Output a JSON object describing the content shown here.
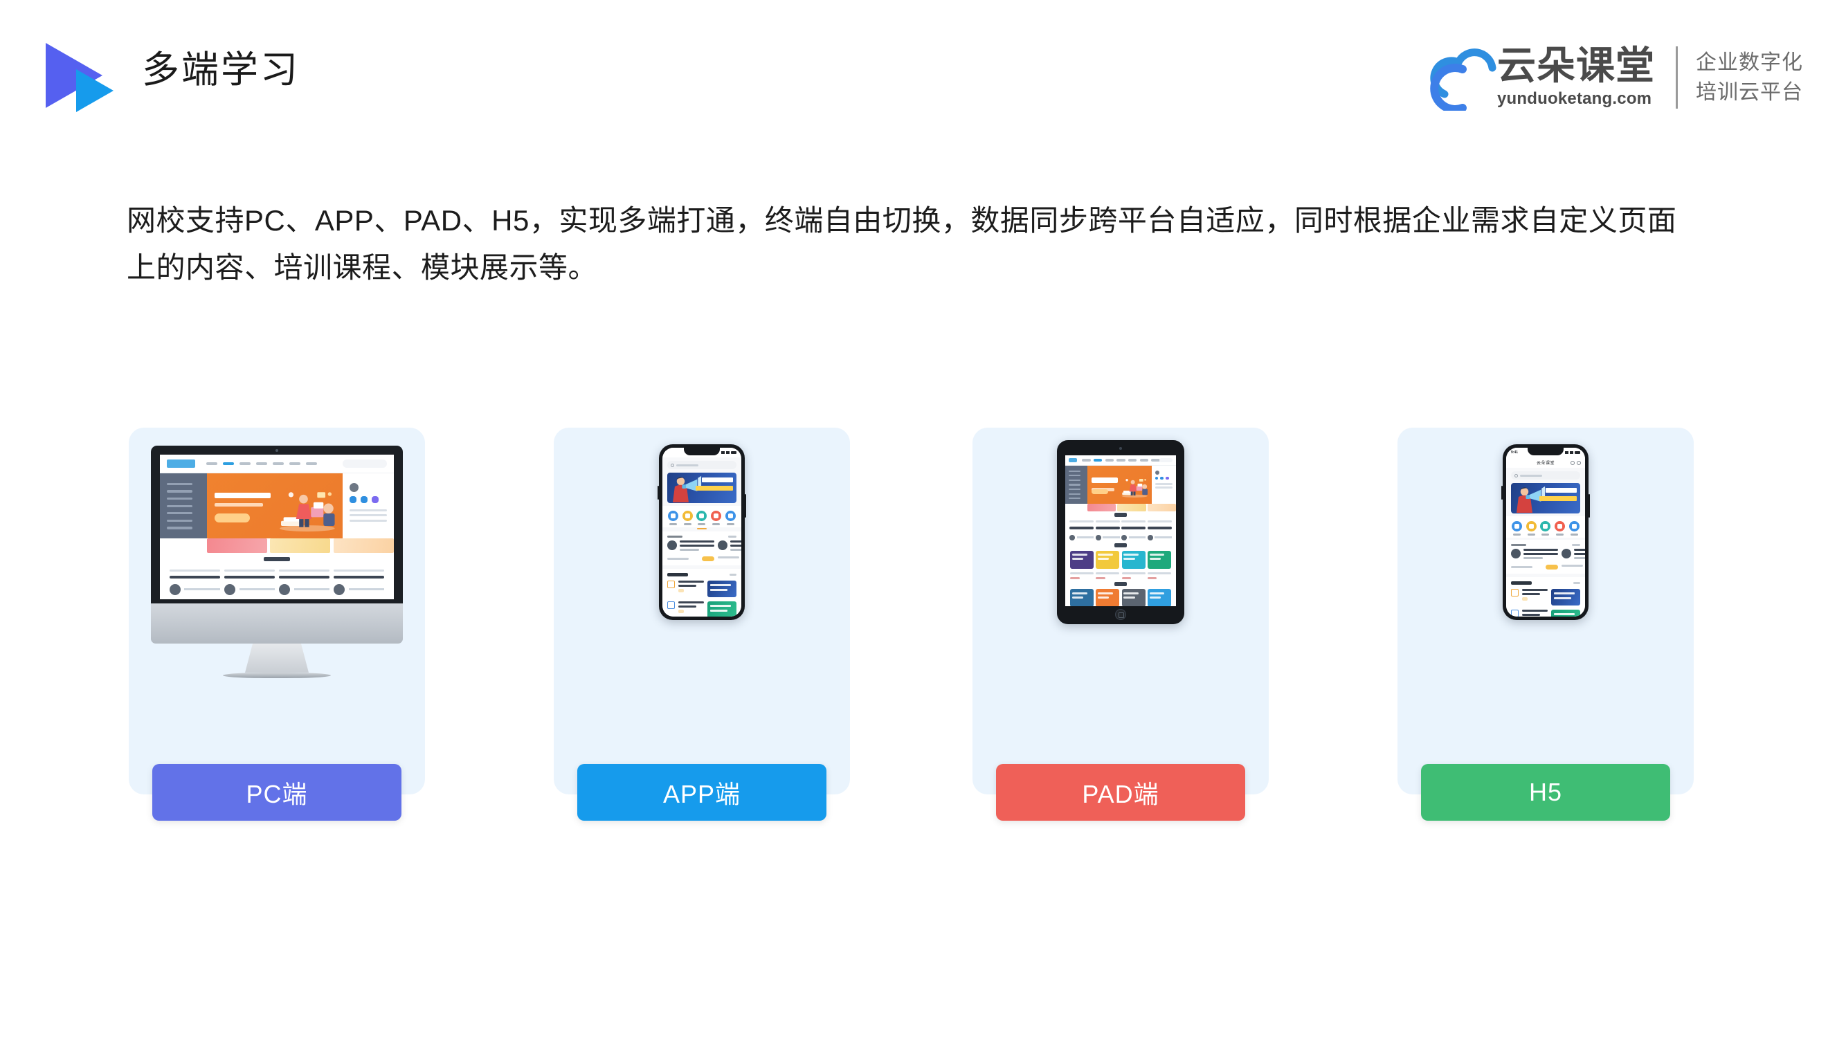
{
  "header": {
    "title": "多端学习",
    "logo_icon": "double-play-triangle-icon",
    "logo_colors": {
      "primary": "#5560f0",
      "secondary": "#169bec"
    }
  },
  "brand": {
    "cloud_icon": "cloud-logo-icon",
    "name_cn": "云朵课堂",
    "name_en": "yunduoketang.com",
    "tagline_line1": "企业数字化",
    "tagline_line2": "培训云平台",
    "brand_blue": "#2f8fe0"
  },
  "intro": {
    "line1": "网校支持PC、APP、PAD、H5，实现多端打通，终端自由切换，数据同步跨平台自适应，同时根据企业需求自定义页面",
    "line2": "上的内容、培训课程、模块展示等。"
  },
  "cards": [
    {
      "id": "pc",
      "label": "PC端",
      "device": "desktop-monitor",
      "button_color": "#6272e8",
      "card_bg": "#eaf4fd"
    },
    {
      "id": "app",
      "label": "APP端",
      "device": "smartphone",
      "button_color": "#169bec",
      "card_bg": "#eaf4fd"
    },
    {
      "id": "pad",
      "label": "PAD端",
      "device": "tablet",
      "button_color": "#ef6058",
      "card_bg": "#eaf4fd"
    },
    {
      "id": "h5",
      "label": "H5",
      "device": "smartphone",
      "button_color": "#3fbd74",
      "card_bg": "#eaf4fd"
    }
  ],
  "phone_app": {
    "status_time": "",
    "title": ""
  },
  "phone_h5": {
    "status_time": "9:41",
    "title": "云朵课堂"
  }
}
